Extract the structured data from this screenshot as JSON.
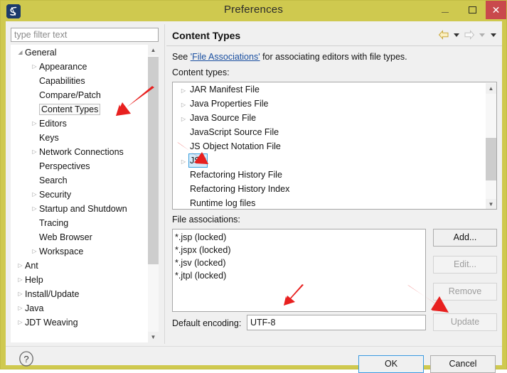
{
  "window": {
    "title": "Preferences",
    "app_icon": "eclipse-icon",
    "minimize_label": "Minimize",
    "maximize_label": "Maximize",
    "close_label": "Close",
    "accent_titlebar": "#cfc94f",
    "close_bg": "#c9494c"
  },
  "sidebar": {
    "filter": {
      "value": "",
      "placeholder": "type filter text"
    },
    "items": [
      {
        "label": "General",
        "level": 0,
        "twisty": "expanded",
        "selected": false
      },
      {
        "label": "Appearance",
        "level": 1,
        "twisty": "collapsed",
        "selected": false
      },
      {
        "label": "Capabilities",
        "level": 1,
        "twisty": "none",
        "selected": false
      },
      {
        "label": "Compare/Patch",
        "level": 1,
        "twisty": "none",
        "selected": false
      },
      {
        "label": "Content Types",
        "level": 1,
        "twisty": "none",
        "selected": true
      },
      {
        "label": "Editors",
        "level": 1,
        "twisty": "collapsed",
        "selected": false
      },
      {
        "label": "Keys",
        "level": 1,
        "twisty": "none",
        "selected": false
      },
      {
        "label": "Network Connections",
        "level": 1,
        "twisty": "collapsed",
        "selected": false
      },
      {
        "label": "Perspectives",
        "level": 1,
        "twisty": "none",
        "selected": false
      },
      {
        "label": "Search",
        "level": 1,
        "twisty": "none",
        "selected": false
      },
      {
        "label": "Security",
        "level": 1,
        "twisty": "collapsed",
        "selected": false
      },
      {
        "label": "Startup and Shutdown",
        "level": 1,
        "twisty": "collapsed",
        "selected": false
      },
      {
        "label": "Tracing",
        "level": 1,
        "twisty": "none",
        "selected": false
      },
      {
        "label": "Web Browser",
        "level": 1,
        "twisty": "none",
        "selected": false
      },
      {
        "label": "Workspace",
        "level": 1,
        "twisty": "collapsed",
        "selected": false
      },
      {
        "label": "Ant",
        "level": 0,
        "twisty": "collapsed",
        "selected": false
      },
      {
        "label": "Help",
        "level": 0,
        "twisty": "collapsed",
        "selected": false
      },
      {
        "label": "Install/Update",
        "level": 0,
        "twisty": "collapsed",
        "selected": false
      },
      {
        "label": "Java",
        "level": 0,
        "twisty": "collapsed",
        "selected": false
      },
      {
        "label": "JDT Weaving",
        "level": 0,
        "twisty": "collapsed",
        "selected": false
      }
    ]
  },
  "page": {
    "title": "Content Types",
    "nav": {
      "back_icon": "back-arrow-icon",
      "back_dropdown_icon": "chevron-down-icon",
      "forward_icon": "forward-arrow-icon",
      "forward_dropdown_icon": "chevron-down-icon",
      "menu_icon": "chevron-down-icon"
    },
    "description_prefix": "See ",
    "description_link": "'File Associations'",
    "description_suffix": " for associating editors with file types.",
    "content_types_label": "Content types:",
    "content_types": [
      {
        "label": "JAR Manifest File",
        "twisty": "collapsed",
        "selected": false
      },
      {
        "label": "Java Properties File",
        "twisty": "collapsed",
        "selected": false
      },
      {
        "label": "Java Source File",
        "twisty": "collapsed",
        "selected": false
      },
      {
        "label": "JavaScript Source File",
        "twisty": "none",
        "selected": false
      },
      {
        "label": "JS Object Notation File",
        "twisty": "none",
        "selected": false
      },
      {
        "label": "JSP",
        "twisty": "collapsed",
        "selected": true
      },
      {
        "label": "Refactoring History File",
        "twisty": "none",
        "selected": false
      },
      {
        "label": "Refactoring History Index",
        "twisty": "none",
        "selected": false
      },
      {
        "label": "Runtime log files",
        "twisty": "none",
        "selected": false
      }
    ],
    "file_associations_label": "File associations:",
    "file_associations": [
      "*.jsp (locked)",
      "*.jspx (locked)",
      "*.jsv (locked)",
      "*.jtpl (locked)"
    ],
    "buttons": {
      "add": {
        "label": "Add...",
        "enabled": true
      },
      "edit": {
        "label": "Edit...",
        "enabled": false
      },
      "remove": {
        "label": "Remove",
        "enabled": false
      },
      "update": {
        "label": "Update",
        "enabled": false
      }
    },
    "encoding_label": "Default encoding:",
    "encoding_value": "UTF-8",
    "selection_highlight": "#d5ebfb",
    "selection_border": "#3ea0dd"
  },
  "footer": {
    "help_icon": "help-question-icon",
    "ok_label": "OK",
    "cancel_label": "Cancel"
  },
  "annotations": {
    "color": "#e8201f",
    "arrows": [
      {
        "name": "arrow-to-content-types",
        "target": "Content Types"
      },
      {
        "name": "arrow-to-jsp",
        "target": "JSP"
      },
      {
        "name": "arrow-to-default-encoding",
        "target": "Default encoding"
      },
      {
        "name": "arrow-to-update-button",
        "target": "Update"
      }
    ]
  }
}
